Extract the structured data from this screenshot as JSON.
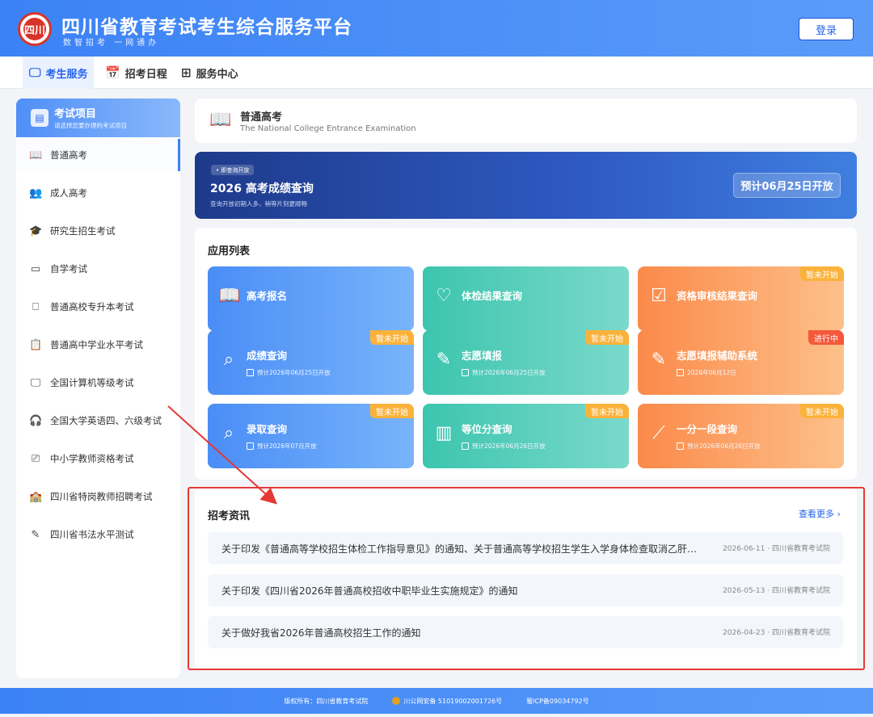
{
  "header": {
    "logo_text": "四川",
    "title": "四川省教育考试考生综合服务平台",
    "subtitle": "数智招考 一网通办",
    "login_label": "登录"
  },
  "nav": {
    "items": [
      {
        "label": "考生服务",
        "icon": "monitor-icon"
      },
      {
        "label": "招考日程",
        "icon": "calendar-icon"
      },
      {
        "label": "服务中心",
        "icon": "grid-icon"
      }
    ]
  },
  "sidebar": {
    "head_title": "考试项目",
    "head_sub": "请选择您要办理的考试项目",
    "items": [
      {
        "label": "普通高考"
      },
      {
        "label": "成人高考"
      },
      {
        "label": "研究生招生考试"
      },
      {
        "label": "自学考试"
      },
      {
        "label": "普通高校专升本考试"
      },
      {
        "label": "普通高中学业水平考试"
      },
      {
        "label": "全国计算机等级考试"
      },
      {
        "label": "全国大学英语四、六级考试"
      },
      {
        "label": "中小学教师资格考试"
      },
      {
        "label": "四川省特岗教师招聘考试"
      },
      {
        "label": "四川省书法水平测试"
      }
    ]
  },
  "exam_header": {
    "title": "普通高考",
    "subtitle": "The National College Entrance Examination"
  },
  "banner": {
    "tag": "• 即查询开放",
    "title": "2026 高考成绩查询",
    "subtitle": "查询开放初期人多，稍等片刻更顺畅",
    "button": "预计06月25日开放"
  },
  "apps": {
    "title": "应用列表",
    "tiles": [
      {
        "name": "高考报名",
        "date": "",
        "badge": "",
        "color": "blue",
        "icon": "book-icon"
      },
      {
        "name": "体检结果查询",
        "date": "",
        "badge": "",
        "color": "teal",
        "icon": "heart-pulse-icon"
      },
      {
        "name": "资格审核结果查询",
        "date": "",
        "badge": "暂未开始",
        "color": "orange",
        "icon": "clipboard-check-icon"
      },
      {
        "name": "成绩查询",
        "date": "预计2026年06月25日开放",
        "badge": "暂未开始",
        "color": "blue",
        "icon": "search-icon"
      },
      {
        "name": "志愿填报",
        "date": "预计2026年06月25日开放",
        "badge": "暂未开始",
        "color": "teal",
        "icon": "edit-icon"
      },
      {
        "name": "志愿填报辅助系统",
        "date": "2026年06月12日",
        "badge": "进行中",
        "color": "orange",
        "icon": "edit-icon"
      },
      {
        "name": "录取查询",
        "date": "预计2026年07月开放",
        "badge": "暂未开始",
        "color": "blue",
        "icon": "search-icon"
      },
      {
        "name": "等位分查询",
        "date": "预计2026年06月26日开放",
        "badge": "暂未开始",
        "color": "teal",
        "icon": "bar-chart-icon"
      },
      {
        "name": "一分一段查询",
        "date": "预计2026年06月26日开放",
        "badge": "暂未开始",
        "color": "orange",
        "icon": "line-chart-icon"
      }
    ]
  },
  "news": {
    "title": "招考资讯",
    "more": "查看更多 ›",
    "items": [
      {
        "text": "关于印发《普通高等学校招生体检工作指导意见》的通知、关于普通高等学校招生学生入学身体检查取消乙肝项目检测有关问题的通知",
        "date": "2026-06-11",
        "source": "四川省教育考试院"
      },
      {
        "text": "关于印发《四川省2026年普通高校招收中职毕业生实施规定》的通知",
        "date": "2026-05-13",
        "source": "四川省教育考试院"
      },
      {
        "text": "关于做好我省2026年普通高校招生工作的通知",
        "date": "2026-04-23",
        "source": "四川省教育考试院"
      }
    ]
  },
  "footer": {
    "copyright": "版权所有：四川省教育考试院",
    "police": "川公网安备 51019002001726号",
    "icp": "蜀ICP备09034792号"
  },
  "colors": {
    "brand_blue": "#3b82f6",
    "badge_pending": "#fbb23b",
    "badge_active": "#f5583a",
    "highlight_red": "#e53935"
  }
}
